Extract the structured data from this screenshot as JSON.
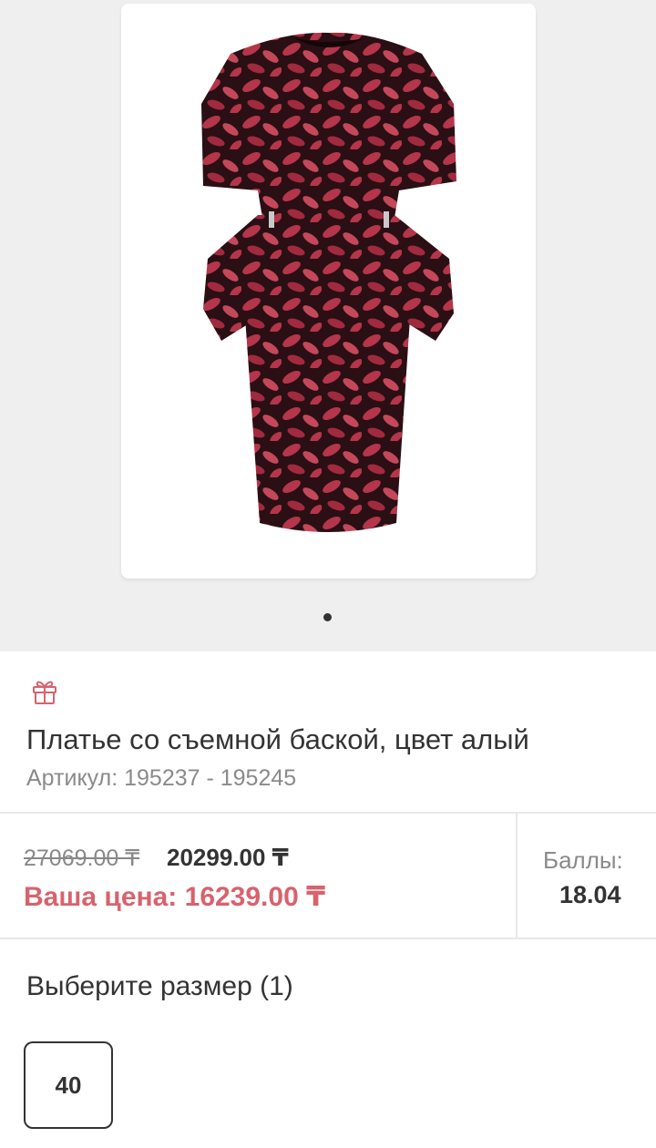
{
  "product": {
    "image_alt": "dress-photo",
    "title": "Платье со съемной баской, цвет алый",
    "sku_label": "Артикул:",
    "sku_value": "195237 - 195245"
  },
  "gallery": {
    "slide_count": 1,
    "active_slide": 1
  },
  "pricing": {
    "old_price": "27069.00 ₸",
    "new_price": "20299.00 ₸",
    "your_price": "Ваша цена: 16239.00 ₸",
    "points_label": "Баллы:",
    "points_value": "18.04"
  },
  "sizes": {
    "title": "Выберите размер (1)",
    "options": [
      "40"
    ]
  },
  "colors": {
    "accent": "#d9626d",
    "dress_base": "#2a0f14",
    "dress_pattern": "#b5354a"
  }
}
